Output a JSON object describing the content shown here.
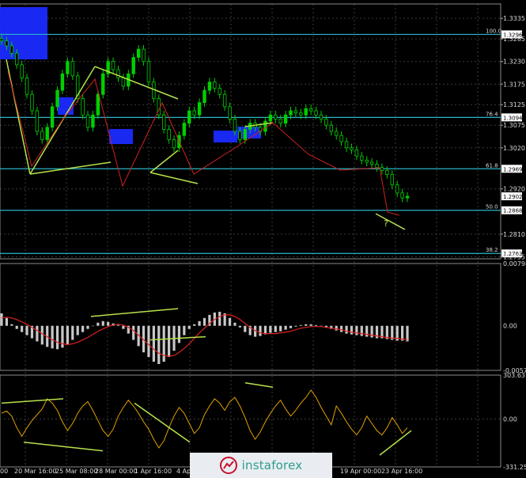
{
  "chart_data": {
    "type": "candlestick",
    "symbol": "",
    "x_labels": [
      "20 Mar 16:00",
      "25 Mar 08:00",
      "28 Mar 00:00",
      "1 Apr 16:00",
      "4 Apr",
      "19 Apr 00:00",
      "23 Apr 16:00"
    ],
    "first_x_label_fragment": "00",
    "price_axis": {
      "ticks": [
        "1.3335",
        "1.3285",
        "1.3230",
        "1.3175",
        "1.3125",
        "1.3075",
        "1.3020",
        "1.2920",
        "1.2810",
        "1.2755"
      ],
      "ylim": [
        1.275,
        1.337
      ],
      "current_price": "1.2902"
    },
    "fib_levels": [
      {
        "ratio": "100.0",
        "price": "1.3296",
        "value": 1.3296
      },
      {
        "ratio": "76.4",
        "price": "1.3094",
        "value": 1.3094
      },
      {
        "ratio": "61.8",
        "price": "1.2969",
        "value": 1.2969
      },
      {
        "ratio": "50.0",
        "price": "1.2868",
        "value": 1.2868
      },
      {
        "ratio": "38.2",
        "price": "1.2763",
        "value": 1.2763
      }
    ],
    "close_series": [
      1.328,
      1.3268,
      1.325,
      1.3222,
      1.319,
      1.315,
      1.311,
      1.306,
      1.304,
      1.307,
      1.312,
      1.316,
      1.32,
      1.323,
      1.3195,
      1.314,
      1.31,
      1.307,
      1.31,
      1.315,
      1.32,
      1.323,
      1.321,
      1.319,
      1.317,
      1.32,
      1.324,
      1.326,
      1.323,
      1.318,
      1.314,
      1.31,
      1.3065,
      1.304,
      1.302,
      1.305,
      1.308,
      1.311,
      1.31,
      1.313,
      1.316,
      1.318,
      1.3165,
      1.315,
      1.312,
      1.309,
      1.306,
      1.304,
      1.3065,
      1.308,
      1.307,
      1.306,
      1.3085,
      1.31,
      1.309,
      1.308,
      1.31,
      1.311,
      1.3105,
      1.31,
      1.3115,
      1.311,
      1.31,
      1.309,
      1.3075,
      1.306,
      1.305,
      1.3035,
      1.302,
      1.3015,
      1.3,
      1.299,
      1.2985,
      1.298,
      1.2972,
      1.2965,
      1.2955,
      1.293,
      1.291,
      1.2898,
      1.2902
    ],
    "indicators": [
      {
        "name": "",
        "type": "histogram",
        "ticks": [
          "0.00798",
          "0.00",
          "-0.00571"
        ],
        "ylim": [
          -0.00571,
          0.00798
        ],
        "values": [
          0.0016,
          0.001,
          0.0002,
          -0.0004,
          -0.0008,
          -0.0012,
          -0.0016,
          -0.002,
          -0.0024,
          -0.0027,
          -0.0029,
          -0.003,
          -0.0028,
          -0.0024,
          -0.0018,
          -0.0012,
          -0.0008,
          -0.0004,
          0.0,
          0.0004,
          0.0006,
          0.0005,
          0.0003,
          0.0001,
          -0.0004,
          -0.001,
          -0.0018,
          -0.0026,
          -0.0034,
          -0.004,
          -0.0046,
          -0.0049,
          -0.0046,
          -0.004,
          -0.0032,
          -0.0022,
          -0.0012,
          -0.0004,
          0.0002,
          0.0006,
          0.001,
          0.0014,
          0.0017,
          0.0018,
          0.0016,
          0.001,
          0.0004,
          -0.0002,
          -0.0008,
          -0.0012,
          -0.0014,
          -0.0013,
          -0.0011,
          -0.0009,
          -0.0008,
          -0.0007,
          -0.0005,
          -0.0003,
          -0.0001,
          0.0001,
          0.0002,
          0.0002,
          0.0001,
          0.0,
          -0.0002,
          -0.0004,
          -0.0006,
          -0.0008,
          -0.001,
          -0.0011,
          -0.0012,
          -0.0013,
          -0.0014,
          -0.0015,
          -0.0016,
          -0.0016,
          -0.0017,
          -0.0018,
          -0.0019,
          -0.0019,
          -0.002
        ],
        "signal": [
          0.001,
          0.0011,
          0.001,
          0.0008,
          0.0005,
          0.0002,
          -0.0002,
          -0.0006,
          -0.001,
          -0.0014,
          -0.0018,
          -0.0021,
          -0.0023,
          -0.0024,
          -0.0023,
          -0.0021,
          -0.0018,
          -0.0015,
          -0.0011,
          -0.0007,
          -0.0004,
          -0.0001,
          0.0001,
          0.0002,
          0.0001,
          -0.0002,
          -0.0006,
          -0.0012,
          -0.0018,
          -0.0024,
          -0.003,
          -0.0035,
          -0.0038,
          -0.0039,
          -0.0038,
          -0.0034,
          -0.0029,
          -0.0023,
          -0.0016,
          -0.0009,
          -0.0003,
          0.0003,
          0.0008,
          0.0012,
          0.0014,
          0.0014,
          0.0012,
          0.0008,
          0.0003,
          -0.0002,
          -0.0006,
          -0.0009,
          -0.001,
          -0.001,
          -0.001,
          -0.0009,
          -0.0008,
          -0.0007,
          -0.0005,
          -0.0003,
          -0.0002,
          -0.0001,
          -0.0001,
          -0.0001,
          -0.0002,
          -0.0003,
          -0.0004,
          -0.0005,
          -0.0007,
          -0.0008,
          -0.0009,
          -0.001,
          -0.0011,
          -0.0012,
          -0.0013,
          -0.0014,
          -0.0015,
          -0.0016,
          -0.0016,
          -0.0017,
          -0.0018
        ]
      },
      {
        "name": "",
        "type": "line",
        "ticks": [
          "303.6317",
          "0.00",
          "-331.259"
        ],
        "ylim": [
          -331.259,
          303.6317
        ],
        "values": [
          40,
          55,
          20,
          -60,
          -120,
          -60,
          -10,
          30,
          70,
          140,
          110,
          60,
          -20,
          -80,
          -30,
          40,
          90,
          120,
          60,
          -10,
          -80,
          -120,
          -70,
          20,
          80,
          130,
          90,
          40,
          -20,
          -70,
          -140,
          -200,
          -150,
          -60,
          20,
          80,
          40,
          -30,
          -100,
          -60,
          30,
          90,
          140,
          110,
          60,
          120,
          150,
          90,
          10,
          -80,
          -140,
          -90,
          -20,
          40,
          90,
          130,
          70,
          20,
          60,
          110,
          150,
          200,
          150,
          80,
          20,
          -40,
          90,
          40,
          -20,
          -70,
          -110,
          -60,
          20,
          -30,
          -80,
          -110,
          -60,
          10,
          -40,
          -100,
          -60
        ]
      }
    ]
  },
  "annotation": {
    "question_mark": "?"
  },
  "watermark": {
    "text": "instaforex"
  },
  "colors": {
    "background": "#000000",
    "grid": "#3a3a3a",
    "candle_up": "#00d000",
    "candle_down": "#00d000",
    "fib_line": "#29b6c6",
    "fib_box": "#ffffff",
    "trendline_green": "#b6e24a",
    "trendline_red": "#cc2222",
    "blue_zone": "#1a2bff",
    "osc_line": "#e0a000",
    "histogram": "#c8c8c8",
    "signal_line": "#dd2222"
  }
}
